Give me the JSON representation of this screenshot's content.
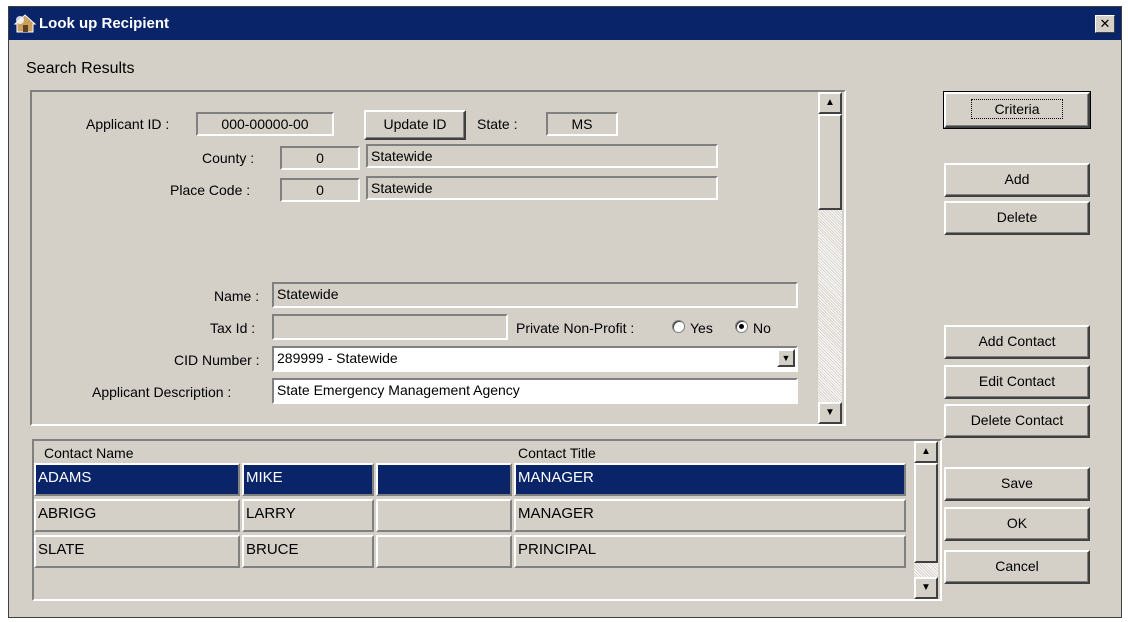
{
  "window": {
    "title": "Look up Recipient",
    "close_label": "✕"
  },
  "section_title": "Search Results",
  "form": {
    "applicant_id_label": "Applicant ID :",
    "applicant_id": "000-00000-00",
    "update_id_label": "Update ID",
    "state_label": "State :",
    "state": "MS",
    "county_label": "County :",
    "county_code": "0",
    "county_name": "Statewide",
    "place_code_label": "Place Code :",
    "place_code": "0",
    "place_name": "Statewide",
    "name_label": "Name :",
    "name": "Statewide",
    "tax_id_label": "Tax Id :",
    "tax_id": "",
    "private_nonprofit_label": "Private Non-Profit :",
    "yes_label": "Yes",
    "no_label": "No",
    "private_nonprofit_selected": "No",
    "cid_label": "CID Number :",
    "cid": "289999 - Statewide",
    "desc_label": "Applicant Description :",
    "description": "State Emergency Management Agency"
  },
  "contacts": {
    "headers": {
      "name": "Contact Name",
      "title": "Contact Title"
    },
    "rows": [
      {
        "last": "ADAMS",
        "first": "MIKE",
        "middle": "",
        "title": "MANAGER"
      },
      {
        "last": "ABRIGG",
        "first": "LARRY",
        "middle": "",
        "title": "MANAGER"
      },
      {
        "last": "SLATE",
        "first": "BRUCE",
        "middle": "",
        "title": "PRINCIPAL"
      }
    ],
    "selected_index": 0
  },
  "buttons": {
    "criteria": "Criteria",
    "add": "Add",
    "delete": "Delete",
    "add_contact": "Add  Contact",
    "edit_contact": "Edit Contact",
    "delete_contact": "Delete Contact",
    "save": "Save",
    "ok": "OK",
    "cancel": "Cancel"
  },
  "colors": {
    "titlebar": "#0a246a",
    "face": "#d4d0c8",
    "selection": "#0a246a"
  },
  "icons": [
    "app-icon",
    "close-icon",
    "scroll-up-icon",
    "scroll-down-icon",
    "dropdown-arrow-icon"
  ]
}
